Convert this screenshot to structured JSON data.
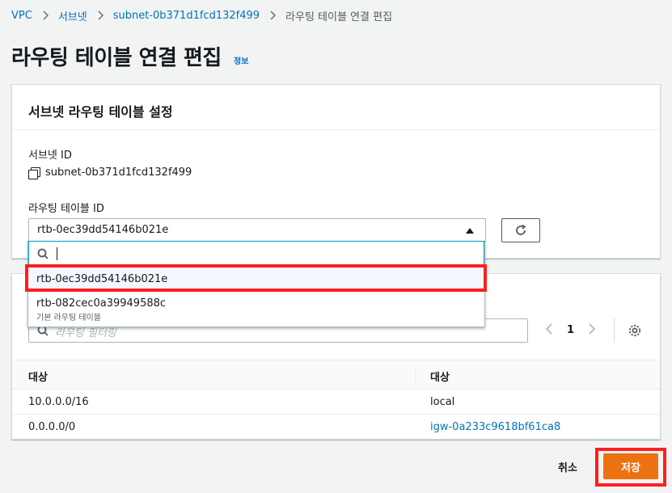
{
  "breadcrumb": {
    "items": [
      "VPC",
      "서브넷",
      "subnet-0b371d1fcd132f499",
      "라우팅 테이블 연결 편집"
    ]
  },
  "page": {
    "title": "라우팅 테이블 연결 편집",
    "info_link": "정보"
  },
  "settings_panel": {
    "title": "서브넷 라우팅 테이블 설정",
    "subnet_id_label": "서브넷 ID",
    "subnet_id_value": "subnet-0b371d1fcd132f499",
    "route_table_label": "라우팅 테이블 ID",
    "route_table_selected": "rtb-0ec39dd54146b021e"
  },
  "dropdown": {
    "search_value": "",
    "options": [
      {
        "label": "rtb-0ec39dd54146b021e",
        "description": ""
      },
      {
        "label": "rtb-082cec0a39949588c",
        "description": "기본 라우팅 테이블"
      }
    ]
  },
  "routes_panel": {
    "filter_placeholder": "라우팅 필터링",
    "page_number": "1",
    "columns": [
      "대상",
      "대상"
    ],
    "rows": [
      {
        "destination": "10.0.0.0/16",
        "target": "local"
      },
      {
        "destination": "0.0.0.0/0",
        "target": "igw-0a233c9618bf61ca8"
      }
    ]
  },
  "footer": {
    "cancel_label": "취소",
    "save_label": "저장"
  },
  "colors": {
    "link": "#0073bb",
    "primary_button": "#ec7211",
    "highlight_box": "#ff1f1f",
    "focus": "#00a1c9"
  }
}
